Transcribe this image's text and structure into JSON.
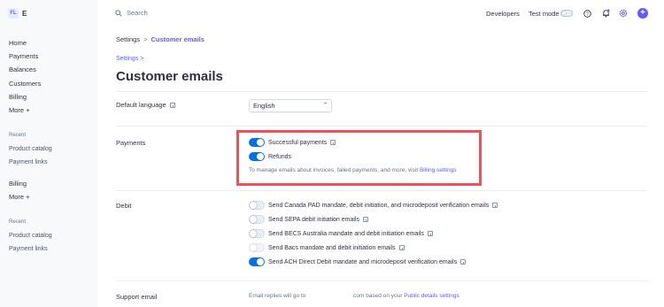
{
  "sidebar": {
    "logo_initials": "FL",
    "logo_name": "E",
    "items": [
      {
        "label": "Home"
      },
      {
        "label": "Payments"
      },
      {
        "label": "Balances"
      },
      {
        "label": "Customers"
      },
      {
        "label": "Billing"
      },
      {
        "label": "More +"
      }
    ],
    "recent_1": {
      "title": "Recent",
      "items": [
        "Product catalog",
        "Payment links"
      ]
    },
    "billing_group": {
      "billing": "Billing",
      "more": "More +"
    },
    "recent_2": {
      "title": "Recent",
      "items": [
        "Product catalog",
        "Payment links"
      ]
    }
  },
  "topbar": {
    "search_placeholder": "Search",
    "developers": "Developers",
    "test_mode": "Test mode",
    "test_mode_on": false
  },
  "breadcrumb": {
    "parent": "Settings",
    "separator": ">",
    "current": "Customer emails"
  },
  "back_link": "Settings  >",
  "page_title": "Customer emails",
  "sections": {
    "language": {
      "label": "Default language",
      "value": "English"
    },
    "payments": {
      "label": "Payments",
      "toggles": [
        {
          "label": "Successful payments",
          "on": true,
          "info": true
        },
        {
          "label": "Refunds",
          "on": true,
          "info": false
        }
      ],
      "helper_text": "To manage emails about invoices, failed payments, and more, visit ",
      "helper_link": "Billing settings"
    },
    "debit": {
      "label": "Debit",
      "toggles": [
        {
          "label": "Send Canada PAD mandate, debit initiation, and microdeposit verification emails",
          "on": false
        },
        {
          "label": "Send SEPA debit initiation emails",
          "on": false
        },
        {
          "label": "Send BECS Australia mandate and debit initiation emails",
          "on": false
        },
        {
          "label": "Send Bacs mandate and debit initiation emails",
          "on": false,
          "disabled": true
        },
        {
          "label": "Send ACH Direct Debit mandate and microdeposit verification emails",
          "on": true
        }
      ]
    },
    "support": {
      "label": "Support email",
      "text_before": "Email replies will go to",
      "text_after": ".com based on your ",
      "link": "Public details settings"
    }
  },
  "colors": {
    "accent": "#635bff",
    "toggle_on": "#0570de",
    "highlight": "#f0505c"
  }
}
